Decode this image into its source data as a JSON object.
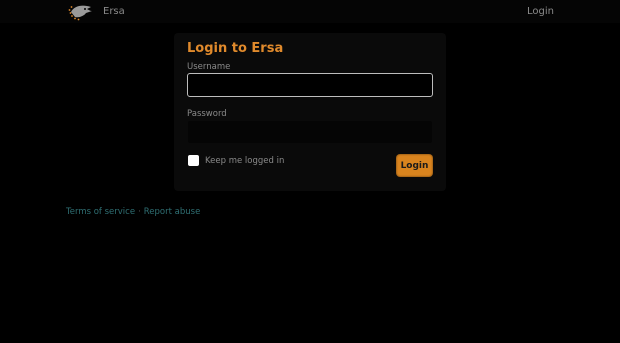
{
  "navbar": {
    "brand": "Ersa",
    "login_link": "Login"
  },
  "login": {
    "title": "Login to Ersa",
    "username_label": "Username",
    "username_value": "",
    "password_label": "Password",
    "password_value": "",
    "keep_logged_in_label": "Keep me logged in",
    "keep_logged_in_checked": false,
    "submit_label": "Login"
  },
  "footer": {
    "terms": "Terms of service",
    "separator": "·",
    "report": "Report abuse"
  },
  "colors": {
    "background": "#000000",
    "accent": "#e08a2c",
    "button": "#d9841e",
    "link": "#2f6f73",
    "muted_text": "#8a8a8a"
  },
  "icons": {
    "brand_logo": "bird-logo-icon"
  }
}
